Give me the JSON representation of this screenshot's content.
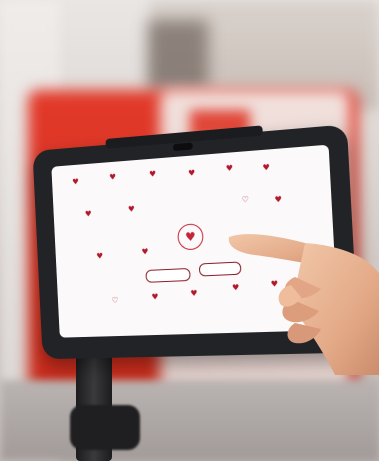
{
  "screen": {
    "title": "",
    "heading": "",
    "subtitle": "",
    "buttons": [
      {
        "label": ""
      },
      {
        "label": ""
      }
    ]
  },
  "colors": {
    "accent": "#b2182b",
    "machine": "#d8301f",
    "tablet_frame": "#222326",
    "screen_bg": "#fbf9f9"
  },
  "icons": {
    "center": "heart-icon",
    "scattered": "heart-icon"
  }
}
